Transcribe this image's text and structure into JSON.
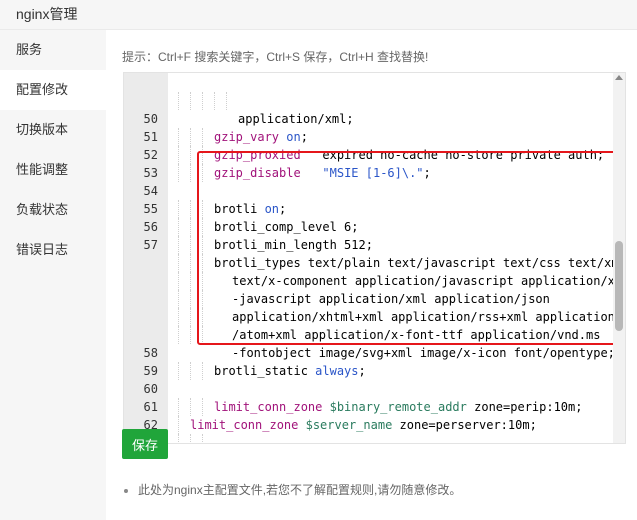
{
  "header": {
    "title": "nginx管理"
  },
  "sidebar": {
    "items": [
      {
        "label": "服务"
      },
      {
        "label": "配置修改"
      },
      {
        "label": "切换版本"
      },
      {
        "label": "性能调整"
      },
      {
        "label": "负载状态"
      },
      {
        "label": "错误日志"
      }
    ]
  },
  "tip": "提示：Ctrl+F 搜索关键字，Ctrl+S 保存，Ctrl+H 查找替换!",
  "editor": {
    "lines": {
      "l0": {
        "num": "",
        "t1": "application/xml;"
      },
      "l1": {
        "num": "50",
        "t1": "gzip_vary",
        "t2": " ",
        "t3": "on",
        "t4": ";"
      },
      "l2": {
        "num": "51",
        "t1": "gzip_proxied",
        "t2": "   expired no-cache no-store private auth;"
      },
      "l3": {
        "num": "52",
        "t1": "gzip_disable",
        "t2": "   ",
        "t3": "\"MSIE [1-6]\\.\"",
        "t4": ";"
      },
      "l4": {
        "num": "53"
      },
      "l5": {
        "num": "54",
        "t1": "brotli ",
        "t2": "on",
        "t3": ";"
      },
      "l6": {
        "num": "55",
        "t1": "brotli_comp_level 6;"
      },
      "l7": {
        "num": "56",
        "t1": "brotli_min_length 512;"
      },
      "l8": {
        "num": "57",
        "t1": "brotli_types text/plain text/javascript text/css text/xml"
      },
      "l9": {
        "num": "",
        "t1": "text/x-component application/javascript application/x"
      },
      "l10": {
        "num": "",
        "t1": "-javascript application/xml application/json"
      },
      "l11": {
        "num": "",
        "t1": "application/xhtml+xml application/rss+xml application"
      },
      "l12": {
        "num": "",
        "t1": "/atom+xml application/x-font-ttf application/vnd.ms"
      },
      "l13": {
        "num": "",
        "t1": "-fontobject image/svg+xml image/x-icon font/opentype;"
      },
      "l14": {
        "num": "58",
        "t1": "brotli_static ",
        "t2": "always",
        "t3": ";"
      },
      "l15": {
        "num": "59"
      },
      "l16": {
        "num": "60",
        "t1": "limit_conn_zone",
        "t2": " ",
        "t3": "$binary_remote_addr",
        "t4": " zone=perip:10m;"
      },
      "l17": {
        "num": "61",
        "t1": "limit_conn_zone",
        "t2": " ",
        "t3": "$server_name",
        "t4": " zone=perserver:10m;"
      },
      "l18": {
        "num": "62"
      }
    }
  },
  "save_button": {
    "label": "保存"
  },
  "note": "此处为nginx主配置文件,若您不了解配置规则,请勿随意修改。",
  "colors": {
    "accent": "#20a53a",
    "highlight_border": "#e5161b",
    "keyword": "#a1127a",
    "value": "#2a55c8",
    "variable": "#2a7b5e"
  }
}
